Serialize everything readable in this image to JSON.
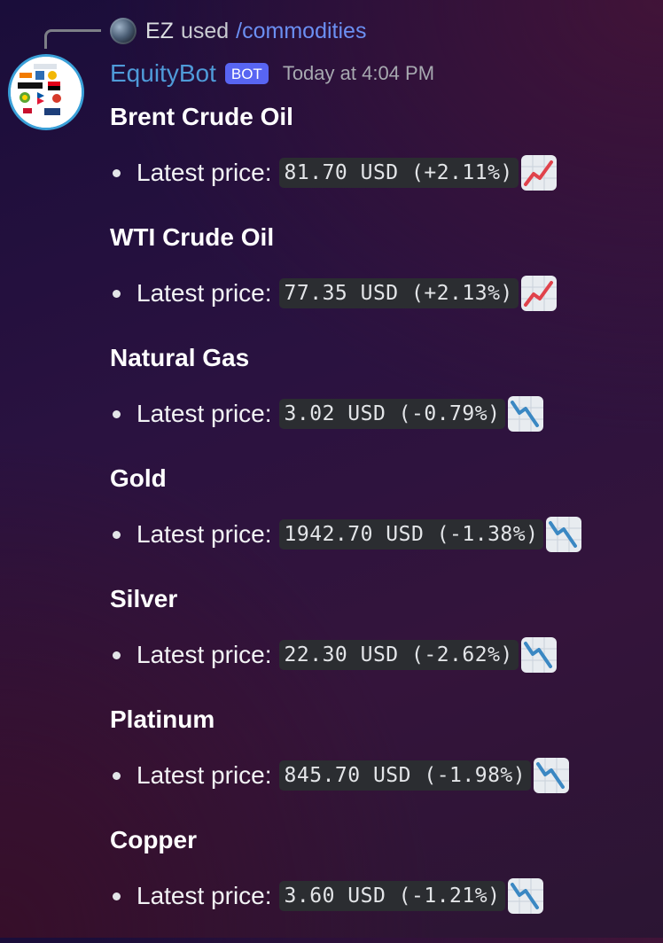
{
  "reply": {
    "user": "EZ",
    "used_text": "used",
    "command": "/commodities"
  },
  "bot": {
    "name": "EquityBot",
    "tag": "BOT",
    "timestamp": "Today at 4:04 PM",
    "avatar_logos": [
      "ING",
      "KOCH",
      "SOCIETE GENERALE",
      "Reliance",
      "Chevron",
      "bp"
    ]
  },
  "price_label": "Latest price:",
  "commodities": [
    {
      "name": "Brent Crude Oil",
      "price": "81.70 USD (+2.11%)",
      "trend_icon": "chart-increasing-icon"
    },
    {
      "name": "WTI Crude Oil",
      "price": "77.35 USD (+2.13%)",
      "trend_icon": "chart-increasing-icon"
    },
    {
      "name": "Natural Gas",
      "price": "3.02 USD (-0.79%)",
      "trend_icon": "chart-decreasing-icon"
    },
    {
      "name": "Gold",
      "price": "1942.70 USD (-1.38%)",
      "trend_icon": "chart-decreasing-icon"
    },
    {
      "name": "Silver",
      "price": "22.30 USD (-2.62%)",
      "trend_icon": "chart-decreasing-icon"
    },
    {
      "name": "Platinum",
      "price": "845.70 USD (-1.98%)",
      "trend_icon": "chart-decreasing-icon"
    },
    {
      "name": "Copper",
      "price": "3.60 USD (-1.21%)",
      "trend_icon": "chart-decreasing-icon"
    }
  ],
  "colors": {
    "bot_name": "#4f9bd9",
    "bot_tag": "#5865f2",
    "command_link": "#6b8ff2",
    "trend_up": "#e0424b",
    "trend_down": "#3b88c3"
  }
}
